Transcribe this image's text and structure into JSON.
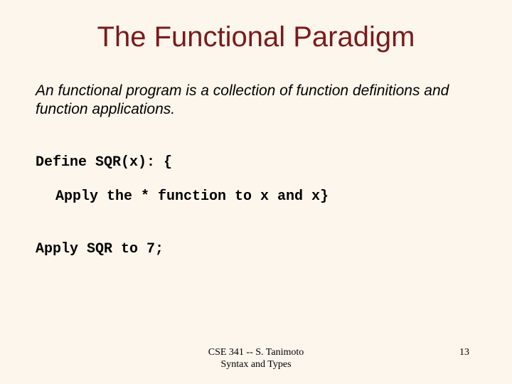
{
  "title": "The Functional Paradigm",
  "intro": "An functional program is a collection of function definitions and function applications.",
  "code": {
    "line1": "Define SQR(x): {",
    "line2": "Apply the * function to x and x}",
    "line3": "Apply SQR to 7;"
  },
  "footer": {
    "line1": "CSE 341 -- S. Tanimoto",
    "line2": "Syntax and Types",
    "page": "13"
  }
}
